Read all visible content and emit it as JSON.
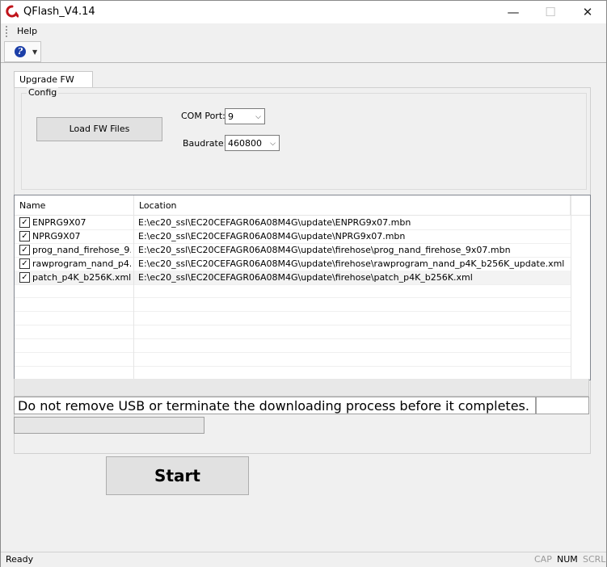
{
  "window": {
    "title": "QFlash_V4.14",
    "minimize": "—",
    "maximize": "☐",
    "close": "✕"
  },
  "menu": {
    "help": "Help"
  },
  "toolbar": {
    "help_icon": "?",
    "dropdown": "▼"
  },
  "tabs": [
    {
      "label": "Upgrade FW"
    }
  ],
  "config": {
    "group_label": "Config",
    "load_button": "Load FW Files",
    "com_port_label": "COM Port:",
    "com_port_value": "9",
    "baudrate_label": "Baudrate:",
    "baudrate_value": "460800"
  },
  "file_list": {
    "columns": [
      "Name",
      "Location"
    ],
    "rows": [
      {
        "checked": true,
        "name": "ENPRG9X07",
        "location": "E:\\ec20_ssl\\EC20CEFAGR06A08M4G\\update\\ENPRG9x07.mbn"
      },
      {
        "checked": true,
        "name": "NPRG9X07",
        "location": "E:\\ec20_ssl\\EC20CEFAGR06A08M4G\\update\\NPRG9x07.mbn"
      },
      {
        "checked": true,
        "name": "prog_nand_firehose_9...",
        "location": "E:\\ec20_ssl\\EC20CEFAGR06A08M4G\\update\\firehose\\prog_nand_firehose_9x07.mbn"
      },
      {
        "checked": true,
        "name": "rawprogram_nand_p4...",
        "location": "E:\\ec20_ssl\\EC20CEFAGR06A08M4G\\update\\firehose\\rawprogram_nand_p4K_b256K_update.xml"
      },
      {
        "checked": true,
        "name": "patch_p4K_b256K.xml",
        "location": "E:\\ec20_ssl\\EC20CEFAGR06A08M4G\\update\\firehose\\patch_p4K_b256K.xml"
      }
    ]
  },
  "message": "Do not remove USB or terminate the downloading process before it completes.",
  "progress": {
    "value": 0
  },
  "start_button": "Start",
  "status": {
    "text": "Ready",
    "cap": "CAP",
    "num": "NUM",
    "scrl": "SCRL"
  },
  "colors": {
    "app_icon": "#c0141b",
    "help_icon": "#1c3fa8",
    "progress": "#06b025"
  },
  "icons": {
    "app": "qflash-logo-icon",
    "help": "help-icon",
    "checkbox": "checkmark-icon"
  }
}
